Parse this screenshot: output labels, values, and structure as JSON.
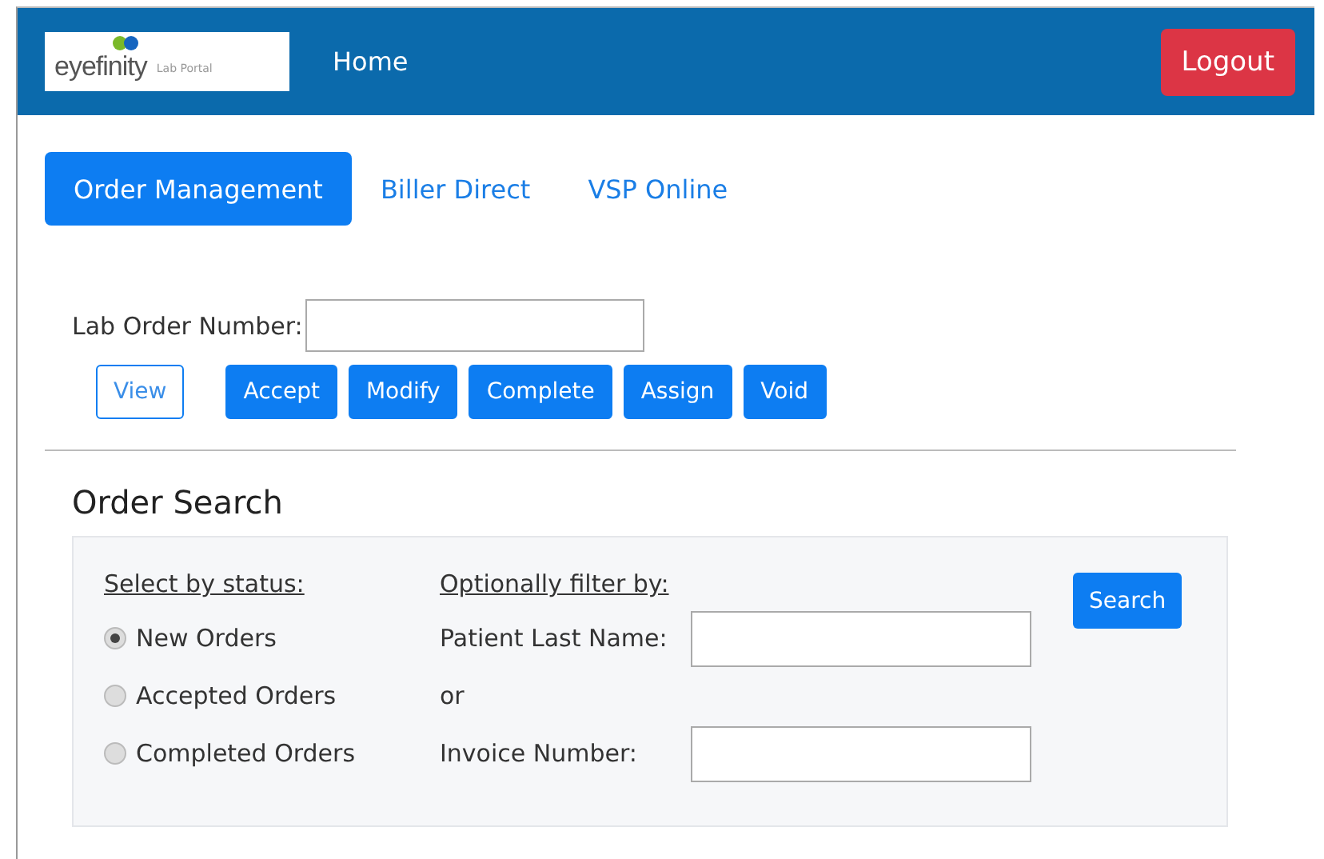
{
  "navbar": {
    "logo": {
      "brand": "eyefinity",
      "subtitle": "Lab Portal"
    },
    "links": [
      "Home"
    ],
    "logout": "Logout"
  },
  "tabs": [
    {
      "label": "Order Management",
      "selected": true
    },
    {
      "label": "Biller Direct",
      "selected": false
    },
    {
      "label": "VSP Online",
      "selected": false
    }
  ],
  "lab_order": {
    "label": "Lab Order Number:",
    "buttons": [
      {
        "label": "View",
        "kind": "outline"
      },
      {
        "label": "Accept",
        "kind": "primary"
      },
      {
        "label": "Modify",
        "kind": "primary"
      },
      {
        "label": "Complete",
        "kind": "primary"
      },
      {
        "label": "Assign",
        "kind": "primary"
      },
      {
        "label": "Void",
        "kind": "primary"
      }
    ]
  },
  "order_search": {
    "title": "Order Search",
    "status_heading": "Select by status:",
    "statuses": [
      {
        "label": "New Orders",
        "selected": true
      },
      {
        "label": "Accepted Orders",
        "selected": false
      },
      {
        "label": "Completed Orders",
        "selected": false
      }
    ],
    "filter_heading": "Optionally filter by:",
    "fields": [
      {
        "label": "Patient Last Name:"
      },
      {
        "label": "Invoice Number:"
      }
    ],
    "separator": "or",
    "search_button": "Search"
  }
}
